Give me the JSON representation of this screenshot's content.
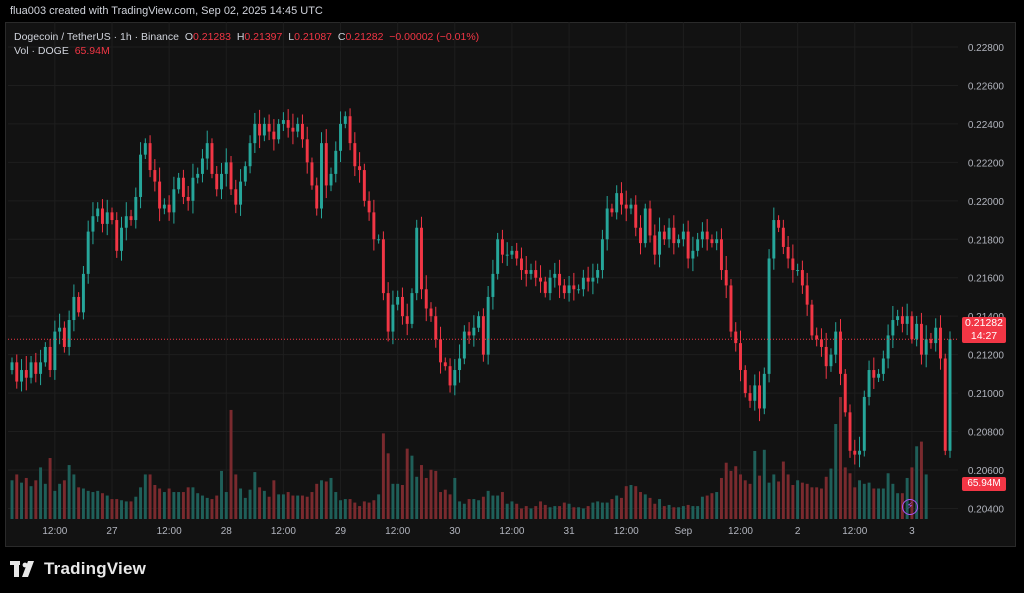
{
  "credit": "flua003 created with TradingView.com, Sep 02, 2025 14:45 UTC",
  "legend": {
    "symbol": "Dogecoin / TetherUS · 1h · Binance",
    "o_label": "O",
    "o_value": "0.21283",
    "h_label": "H",
    "h_value": "0.21397",
    "l_label": "L",
    "l_value": "0.21087",
    "c_label": "C",
    "c_value": "0.21282",
    "change": "−0.00002 (−0.01%)",
    "vol_label": "Vol · DOGE",
    "vol_value": "65.94M"
  },
  "price_tag": {
    "price": "0.21282",
    "countdown": "14:27"
  },
  "vol_tag": "65.94M",
  "brand": {
    "name": "TradingView",
    "logo_icon": "tradingview-logo-icon"
  },
  "colors": {
    "up": "#26a69a",
    "down": "#f23645",
    "up_vol": "#1f5f59",
    "down_vol": "#7a2a2e",
    "grid": "#1e1e1e"
  },
  "chart_data": {
    "type": "candlestick",
    "interval": "1h",
    "symbol": "DOGEUSDT",
    "y_ticks": [
      0.204,
      0.206,
      0.208,
      0.21,
      0.212,
      0.214,
      0.216,
      0.218,
      0.22,
      0.222,
      0.224,
      0.226,
      0.228
    ],
    "y_tick_labels": [
      "0.20400",
      "0.20600",
      "0.20800",
      "0.21000",
      "0.21200",
      "0.21400",
      "0.21600",
      "0.21800",
      "0.22000",
      "0.22200",
      "0.22400",
      "0.22600",
      "0.22800"
    ],
    "ylim": [
      0.2034,
      0.2293
    ],
    "x_labels": [
      {
        "label": "12:00",
        "index": 9
      },
      {
        "label": "27",
        "index": 21
      },
      {
        "label": "12:00",
        "index": 33
      },
      {
        "label": "28",
        "index": 45
      },
      {
        "label": "12:00",
        "index": 57
      },
      {
        "label": "29",
        "index": 69
      },
      {
        "label": "12:00",
        "index": 81
      },
      {
        "label": "30",
        "index": 93
      },
      {
        "label": "12:00",
        "index": 105
      },
      {
        "label": "31",
        "index": 117
      },
      {
        "label": "12:00",
        "index": 129
      },
      {
        "label": "Sep",
        "index": 141
      },
      {
        "label": "12:00",
        "index": 153
      },
      {
        "label": "2",
        "index": 165
      },
      {
        "label": "12:00",
        "index": 177
      },
      {
        "label": "3",
        "index": 189
      }
    ],
    "closes": [
      0.2116,
      0.2106,
      0.2112,
      0.2108,
      0.2116,
      0.211,
      0.2116,
      0.2124,
      0.2112,
      0.2132,
      0.2134,
      0.2124,
      0.2138,
      0.215,
      0.2142,
      0.2162,
      0.2184,
      0.2192,
      0.2196,
      0.2188,
      0.2194,
      0.219,
      0.2174,
      0.2186,
      0.2192,
      0.219,
      0.2202,
      0.2224,
      0.223,
      0.2216,
      0.221,
      0.2196,
      0.2198,
      0.2194,
      0.2206,
      0.2212,
      0.2202,
      0.22,
      0.2212,
      0.2214,
      0.2222,
      0.223,
      0.2214,
      0.2206,
      0.2214,
      0.222,
      0.2206,
      0.2198,
      0.221,
      0.2218,
      0.223,
      0.224,
      0.2234,
      0.224,
      0.2236,
      0.2232,
      0.224,
      0.2242,
      0.2238,
      0.2236,
      0.224,
      0.2232,
      0.222,
      0.2208,
      0.2196,
      0.223,
      0.2208,
      0.2214,
      0.2226,
      0.224,
      0.2244,
      0.223,
      0.2218,
      0.2216,
      0.22,
      0.2194,
      0.218,
      0.218,
      0.2152,
      0.2132,
      0.2146,
      0.215,
      0.214,
      0.2136,
      0.2152,
      0.2186,
      0.2154,
      0.2144,
      0.214,
      0.2128,
      0.2116,
      0.2114,
      0.2104,
      0.2112,
      0.2118,
      0.2132,
      0.213,
      0.2134,
      0.214,
      0.212,
      0.215,
      0.2162,
      0.218,
      0.2172,
      0.2172,
      0.2174,
      0.217,
      0.2164,
      0.2162,
      0.2164,
      0.216,
      0.2158,
      0.2152,
      0.216,
      0.2162,
      0.2156,
      0.2152,
      0.2156,
      0.2154,
      0.2154,
      0.216,
      0.2158,
      0.216,
      0.2164,
      0.218,
      0.2196,
      0.2194,
      0.2204,
      0.2198,
      0.2196,
      0.2198,
      0.2186,
      0.2178,
      0.2196,
      0.2182,
      0.2172,
      0.2184,
      0.218,
      0.2186,
      0.2178,
      0.218,
      0.2184,
      0.217,
      0.2174,
      0.218,
      0.2184,
      0.218,
      0.2178,
      0.218,
      0.2164,
      0.2156,
      0.2132,
      0.2126,
      0.2112,
      0.21,
      0.2096,
      0.2104,
      0.2092,
      0.211,
      0.217,
      0.219,
      0.2186,
      0.2176,
      0.217,
      0.2164,
      0.2164,
      0.2156,
      0.2146,
      0.213,
      0.2128,
      0.2124,
      0.2114,
      0.212,
      0.2132,
      0.211,
      0.209,
      0.207,
      0.2068,
      0.207,
      0.2098,
      0.2112,
      0.2108,
      0.211,
      0.2118,
      0.213,
      0.2138,
      0.214,
      0.2136,
      0.214,
      0.2128,
      0.2136,
      0.212,
      0.2128,
      0.2126,
      0.2134,
      0.2118,
      0.207,
      0.2128
    ],
    "volume_m": [
      33,
      38,
      31,
      35,
      28,
      33,
      44,
      30,
      52,
      24,
      30,
      33,
      46,
      38,
      27,
      26,
      24,
      23,
      24,
      22,
      20,
      17,
      17,
      16,
      15,
      15,
      19,
      27,
      38,
      38,
      29,
      26,
      23,
      26,
      23,
      23,
      23,
      27,
      27,
      22,
      20,
      18,
      17,
      20,
      41,
      23,
      93,
      38,
      26,
      18,
      25,
      40,
      27,
      24,
      19,
      33,
      21,
      21,
      23,
      20,
      20,
      20,
      19,
      23,
      30,
      33,
      32,
      35,
      23,
      16,
      17,
      17,
      14,
      11,
      15,
      14,
      16,
      21,
      73,
      56,
      30,
      30,
      29,
      60,
      54,
      36,
      46,
      35,
      42,
      41,
      23,
      25,
      21,
      35,
      15,
      13,
      17,
      17,
      16,
      19,
      24,
      20,
      20,
      23,
      13,
      15,
      13,
      9,
      11,
      9,
      11,
      15,
      12,
      10,
      11,
      11,
      14,
      13,
      10,
      10,
      9,
      11,
      14,
      15,
      14,
      14,
      17,
      20,
      18,
      28,
      29,
      28,
      23,
      21,
      18,
      13,
      17,
      11,
      12,
      10,
      10,
      11,
      12,
      11,
      11,
      19,
      20,
      22,
      23,
      35,
      48,
      41,
      45,
      38,
      33,
      30,
      58,
      37,
      59,
      31,
      38,
      32,
      49,
      38,
      29,
      33,
      31,
      30,
      27,
      27,
      26,
      36,
      43,
      81,
      104,
      44,
      39,
      27,
      33,
      30,
      31,
      26,
      26,
      26,
      39,
      30,
      22,
      22,
      35,
      44,
      62,
      66,
      38
    ]
  }
}
